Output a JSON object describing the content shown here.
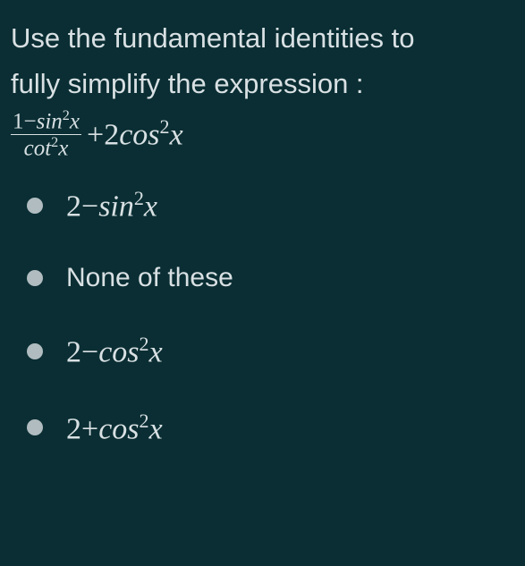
{
  "question": {
    "line1": "Use the fundamental identities to",
    "line2": "fully simplify the expression :"
  },
  "expression": {
    "frac_num_a": "1",
    "frac_num_b": "sin",
    "frac_num_c": "x",
    "frac_den_a": "cot",
    "frac_den_b": "x",
    "plus": "+2",
    "term2_a": "cos",
    "term2_b": "x"
  },
  "options": [
    {
      "prefix": "2",
      "op": "−",
      "func": "sin",
      "var": "x",
      "type": "math"
    },
    {
      "text": "None of these",
      "type": "plain"
    },
    {
      "prefix": "2",
      "op": "−",
      "func": "cos",
      "var": "x",
      "type": "math"
    },
    {
      "prefix": "2",
      "op": "+",
      "func": "cos",
      "var": "x",
      "type": "math"
    }
  ],
  "chart_data": {
    "type": "table",
    "title": "Trig identity simplification multiple choice",
    "expression": "(1 - sin^2 x) / cot^2 x + 2 cos^2 x",
    "choices": [
      "2 - sin^2 x",
      "None of these",
      "2 - cos^2 x",
      "2 + cos^2 x"
    ]
  }
}
